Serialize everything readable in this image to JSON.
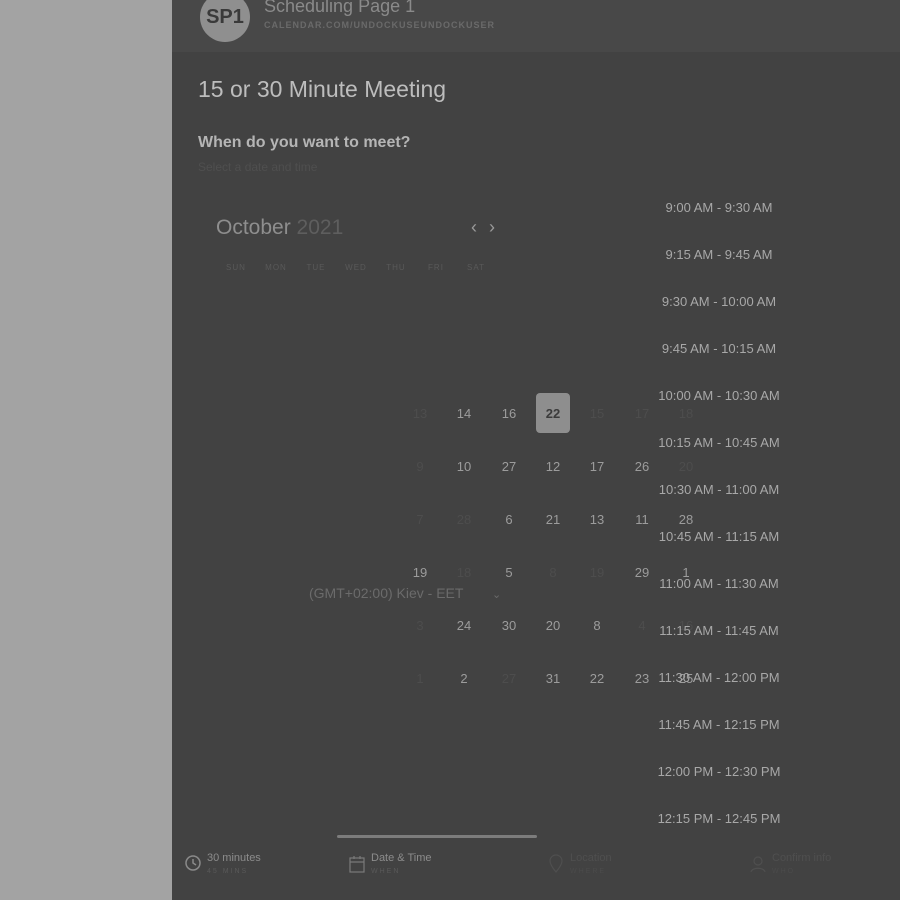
{
  "header": {
    "avatar_initials": "SP1",
    "page_name": "Scheduling Page 1",
    "page_url": "CALENDAR.COM/UNDOCKUSEUNDOCKUSER"
  },
  "meeting": {
    "title": "15 or 30 Minute Meeting",
    "question": "When do you want to meet?",
    "hint": "Select a date and time"
  },
  "calendar": {
    "month": "October",
    "year": "2021",
    "prev_icon": "chevron-left-icon",
    "next_icon": "chevron-right-icon",
    "weekdays": [
      "SUN",
      "MON",
      "TUE",
      "WED",
      "THU",
      "FRI",
      "SAT"
    ],
    "selected_day": "22",
    "days": [
      {
        "label": "13",
        "dim": true
      },
      {
        "label": "14",
        "dim": false
      },
      {
        "label": "16",
        "dim": false
      },
      {
        "label": "22",
        "dim": false,
        "selected": true
      },
      {
        "label": "15",
        "dim": true
      },
      {
        "label": "17",
        "dim": true
      },
      {
        "label": "18",
        "dim": true
      },
      {
        "label": "9",
        "dim": true
      },
      {
        "label": "10",
        "dim": false
      },
      {
        "label": "27",
        "dim": false
      },
      {
        "label": "12",
        "dim": false
      },
      {
        "label": "17",
        "dim": false
      },
      {
        "label": "26",
        "dim": false
      },
      {
        "label": "20",
        "dim": true
      },
      {
        "label": "7",
        "dim": true
      },
      {
        "label": "28",
        "dim": true
      },
      {
        "label": "6",
        "dim": false
      },
      {
        "label": "21",
        "dim": false
      },
      {
        "label": "13",
        "dim": false
      },
      {
        "label": "11",
        "dim": false
      },
      {
        "label": "28",
        "dim": false
      },
      {
        "label": "19",
        "dim": false
      },
      {
        "label": "18",
        "dim": true
      },
      {
        "label": "5",
        "dim": false
      },
      {
        "label": "8",
        "dim": true
      },
      {
        "label": "19",
        "dim": true
      },
      {
        "label": "29",
        "dim": false
      },
      {
        "label": "1",
        "dim": false
      },
      {
        "label": "3",
        "dim": true
      },
      {
        "label": "24",
        "dim": false
      },
      {
        "label": "30",
        "dim": false
      },
      {
        "label": "20",
        "dim": false
      },
      {
        "label": "8",
        "dim": false
      },
      {
        "label": "4",
        "dim": true
      },
      {
        "label": "16",
        "dim": true
      },
      {
        "label": "1",
        "dim": true
      },
      {
        "label": "2",
        "dim": false
      },
      {
        "label": "27",
        "dim": true
      },
      {
        "label": "31",
        "dim": false
      },
      {
        "label": "22",
        "dim": false
      },
      {
        "label": "23",
        "dim": false
      },
      {
        "label": "25",
        "dim": false
      }
    ],
    "timezone": "(GMT+02:00) Kiev - EET",
    "timezone_icon": "chevron-down-icon"
  },
  "time_slots": [
    "9:00 AM - 9:30 AM",
    "9:15 AM - 9:45 AM",
    "9:30 AM - 10:00 AM",
    "9:45 AM - 10:15 AM",
    "10:00 AM - 10:30 AM",
    "10:15 AM - 10:45 AM",
    "10:30 AM - 11:00 AM",
    "10:45 AM - 11:15 AM",
    "11:00 AM - 11:30 AM",
    "11:15 AM - 11:45 AM",
    "11:30 AM - 12:00 PM",
    "11:45 AM - 12:15 PM",
    "12:00 PM - 12:30 PM",
    "12:15 PM - 12:45 PM"
  ],
  "footer": {
    "steps": [
      {
        "title": "30 minutes",
        "sub": "45 MINS",
        "icon": "clock-icon"
      },
      {
        "title": "Date & Time",
        "sub": "WHEN",
        "icon": "calendar-icon"
      },
      {
        "title": "Location",
        "sub": "WHERE",
        "icon": "location-icon"
      },
      {
        "title": "Confirm info",
        "sub": "WHO",
        "icon": "user-icon"
      }
    ]
  }
}
